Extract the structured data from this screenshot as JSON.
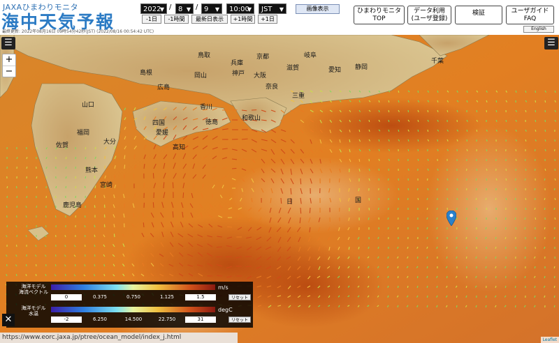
{
  "header": {
    "logo_sub": "JAXAひまわりモニタ",
    "logo_main": "海中天気予報",
    "updated": "最終更新: 2022年08月16日 09時54分42秒(JST)  (2022/08/16 00:54:42 UTC)"
  },
  "date_controls": {
    "year": "2022",
    "month": "8",
    "day": "9",
    "time": "10:00",
    "timezone": "JST",
    "slash1": "/",
    "slash2": "/",
    "minus_day": "-1日",
    "minus_hour": "-1時間",
    "latest": "最新日表示",
    "plus_hour": "+1時間",
    "plus_day": "+1日",
    "image_view": "画像表示"
  },
  "nav": {
    "himawari_top_line1": "ひまわりモニタ",
    "himawari_top_line2": "TOP",
    "data_use_line1": "データ利用",
    "data_use_line2": "(ユーザ登録)",
    "validation": "検証",
    "guide_line1": "ユーザガイド",
    "guide_line2": "FAQ",
    "english": "English"
  },
  "map": {
    "zoom_in": "+",
    "zoom_out": "−",
    "menu_icon": "☰",
    "labels": {
      "kyoto": "京都",
      "osaka": "大阪",
      "kobe": "神戸",
      "hyogo": "兵庫",
      "okayama": "岡山",
      "hiroshima": "広島",
      "shimane": "島根",
      "yamaguchi": "山口",
      "tottori": "鳥取",
      "fukuoka": "福岡",
      "oita": "大分",
      "saga": "佐賀",
      "kumamoto": "熊本",
      "miyazaki": "宮崎",
      "kagoshima": "鹿児島",
      "ehime": "愛媛",
      "kochi": "高知",
      "kagawa": "香川",
      "tokushima": "徳島",
      "wakayama": "和歌山",
      "nara": "奈良",
      "mie": "三重",
      "aichi": "愛知",
      "gifu": "岐阜",
      "shizuoka": "静岡",
      "chiba": "千葉",
      "shiga": "滋賀",
      "shikoku": "四国",
      "nihon": "日",
      "koku": "国"
    }
  },
  "legend": {
    "current_title": "海洋モデル\n海流ベクトル",
    "current_unit": "m/s",
    "current_ticks": [
      "0",
      "0.375",
      "0.750",
      "1.125",
      "1.5"
    ],
    "temp_title": "海洋モデル\n水温",
    "temp_unit": "degC",
    "temp_ticks": [
      "-2",
      "6.250",
      "14.500",
      "22.750",
      "31"
    ],
    "reset": "リセット",
    "close": "✕"
  },
  "status_url": "https://www.eorc.jaxa.jp/ptree/ocean_model/index_j.html",
  "attribution": "Leaflet",
  "colors": {
    "brand_blue": "#2c7bc4",
    "sea_orange": "#e07a1e",
    "warm_core": "#c85a14",
    "land": "#d9c28e",
    "marker": "#2a81cb"
  }
}
